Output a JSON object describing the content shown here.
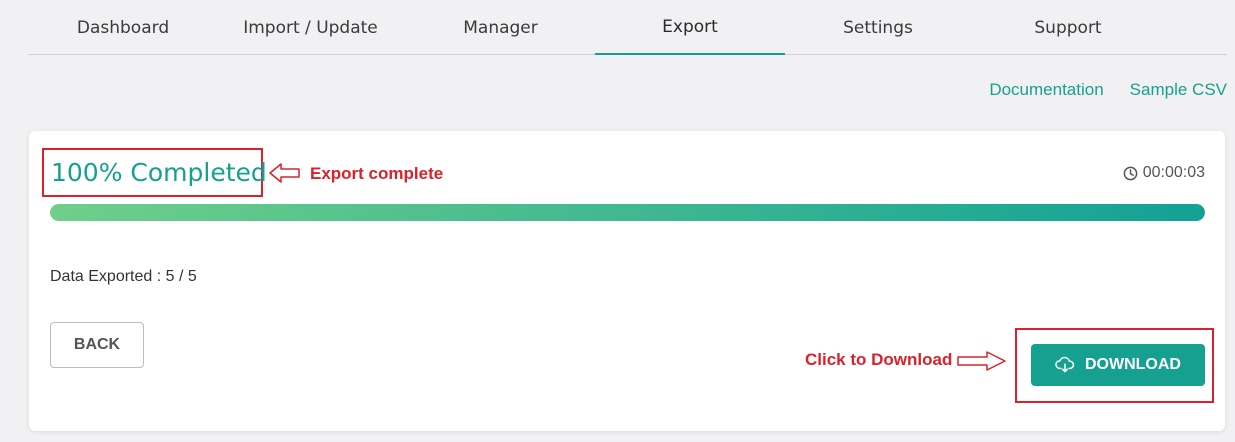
{
  "tabs": [
    {
      "label": "Dashboard",
      "active": false
    },
    {
      "label": "Import / Update",
      "active": false
    },
    {
      "label": "Manager",
      "active": false
    },
    {
      "label": "Export",
      "active": true
    },
    {
      "label": "Settings",
      "active": false
    },
    {
      "label": "Support",
      "active": false
    }
  ],
  "links": {
    "documentation": "Documentation",
    "sample_csv": "Sample CSV"
  },
  "progress": {
    "completed_label": "100% Completed",
    "percent": 100,
    "timer": "00:00:03",
    "timer_icon": "clock-icon"
  },
  "annotations": {
    "export_complete": "Export complete",
    "click_to_download": "Click to Download"
  },
  "data_exported": "Data Exported : 5 / 5",
  "buttons": {
    "back": "BACK",
    "download": "DOWNLOAD",
    "download_icon": "cloud-download-icon"
  },
  "colors": {
    "accent": "#16a08f",
    "annotation_red": "#d9222a",
    "progress_start": "#6fcf8b",
    "progress_end": "#12a196"
  }
}
